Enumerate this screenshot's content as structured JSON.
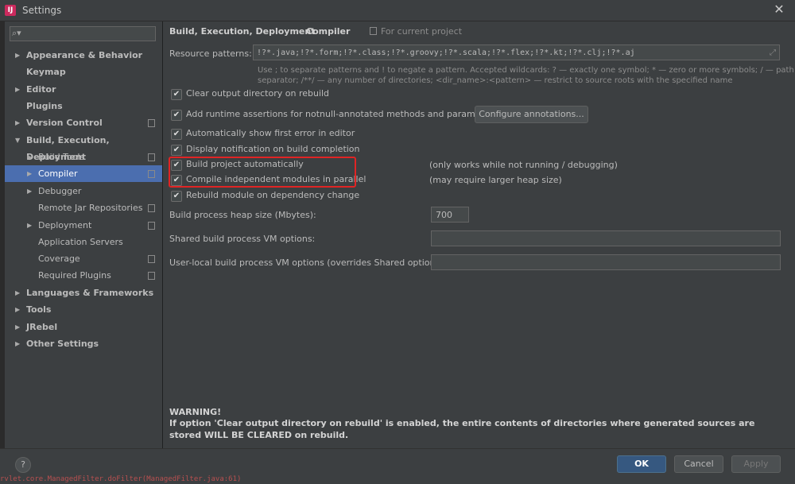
{
  "window": {
    "title": "Settings",
    "app_icon": "intellij-icon"
  },
  "search": {
    "placeholder": "Q"
  },
  "sidebar": {
    "items": [
      {
        "label": "Appearance & Behavior",
        "level": 0,
        "expanded": false,
        "has_arrow": true,
        "bold": true
      },
      {
        "label": "Keymap",
        "level": 0,
        "has_arrow": false,
        "bold": true
      },
      {
        "label": "Editor",
        "level": 0,
        "expanded": false,
        "has_arrow": true,
        "bold": true
      },
      {
        "label": "Plugins",
        "level": 0,
        "has_arrow": false,
        "bold": true
      },
      {
        "label": "Version Control",
        "level": 0,
        "expanded": false,
        "has_arrow": true,
        "bold": true,
        "project_icon": true
      },
      {
        "label": "Build, Execution, Deployment",
        "level": 0,
        "expanded": true,
        "has_arrow": true,
        "bold": true
      },
      {
        "label": "Build Tools",
        "level": 1,
        "expanded": false,
        "has_arrow": true,
        "project_icon": true
      },
      {
        "label": "Compiler",
        "level": 1,
        "expanded": false,
        "has_arrow": true,
        "project_icon": true,
        "selected": true
      },
      {
        "label": "Debugger",
        "level": 1,
        "expanded": false,
        "has_arrow": true
      },
      {
        "label": "Remote Jar Repositories",
        "level": 1,
        "project_icon": true
      },
      {
        "label": "Deployment",
        "level": 1,
        "expanded": false,
        "has_arrow": true,
        "project_icon": true
      },
      {
        "label": "Application Servers",
        "level": 1
      },
      {
        "label": "Coverage",
        "level": 1,
        "project_icon": true
      },
      {
        "label": "Required Plugins",
        "level": 1,
        "project_icon": true
      },
      {
        "label": "Languages & Frameworks",
        "level": 0,
        "expanded": false,
        "has_arrow": true,
        "bold": true
      },
      {
        "label": "Tools",
        "level": 0,
        "expanded": false,
        "has_arrow": true,
        "bold": true
      },
      {
        "label": "JRebel",
        "level": 0,
        "expanded": false,
        "has_arrow": true,
        "bold": true
      },
      {
        "label": "Other Settings",
        "level": 0,
        "expanded": false,
        "has_arrow": true,
        "bold": true
      }
    ]
  },
  "breadcrumb": {
    "parent": "Build, Execution, Deployment",
    "separator": "›",
    "current": "Compiler",
    "scope": "For current project"
  },
  "resource_patterns": {
    "label": "Resource patterns:",
    "value": "!?*.java;!?*.form;!?*.class;!?*.groovy;!?*.scala;!?*.flex;!?*.kt;!?*.clj;!?*.aj",
    "hint_line1": "Use ; to separate patterns and ! to negate a pattern. Accepted wildcards: ? — exactly one symbol; * — zero or more symbols; / — path",
    "hint_line2": "separator; /**/ — any number of directories; <dir_name>:<pattern> — restrict to source roots with the specified name"
  },
  "options": [
    {
      "label": "Clear output directory on rebuild",
      "checked": true
    },
    {
      "label": "Add runtime assertions for notnull-annotated methods and parameters",
      "checked": true
    },
    {
      "label": "Automatically show first error in editor",
      "checked": true
    },
    {
      "label": "Display notification on build completion",
      "checked": true
    },
    {
      "label": "Build project automatically",
      "checked": true,
      "note": "(only works while not running / debugging)"
    },
    {
      "label": "Compile independent modules in parallel",
      "checked": true,
      "note": "(may require larger heap size)"
    },
    {
      "label": "Rebuild module on dependency change",
      "checked": true
    }
  ],
  "configure_button": {
    "label": "Configure annotations..."
  },
  "heap": {
    "label": "Build process heap size (Mbytes):",
    "value": "700"
  },
  "shared_vm": {
    "label": "Shared build process VM options:",
    "value": ""
  },
  "user_vm": {
    "label": "User-local build process VM options (overrides Shared options):",
    "value": ""
  },
  "warning": {
    "title": "WARNING!",
    "text": "If option 'Clear output directory on rebuild' is enabled, the entire contents of directories where generated sources are stored WILL BE CLEARED on rebuild."
  },
  "footer": {
    "help": "?",
    "ok": "OK",
    "cancel": "Cancel",
    "apply": "Apply"
  },
  "background_log": "rvlet.core.ManagedFilter.doFilter(ManagedFilter.java:61)",
  "colors": {
    "selection": "#4b6eaf",
    "highlight": "#e02424",
    "panel": "#3c3f41",
    "ok_button": "#365880"
  }
}
